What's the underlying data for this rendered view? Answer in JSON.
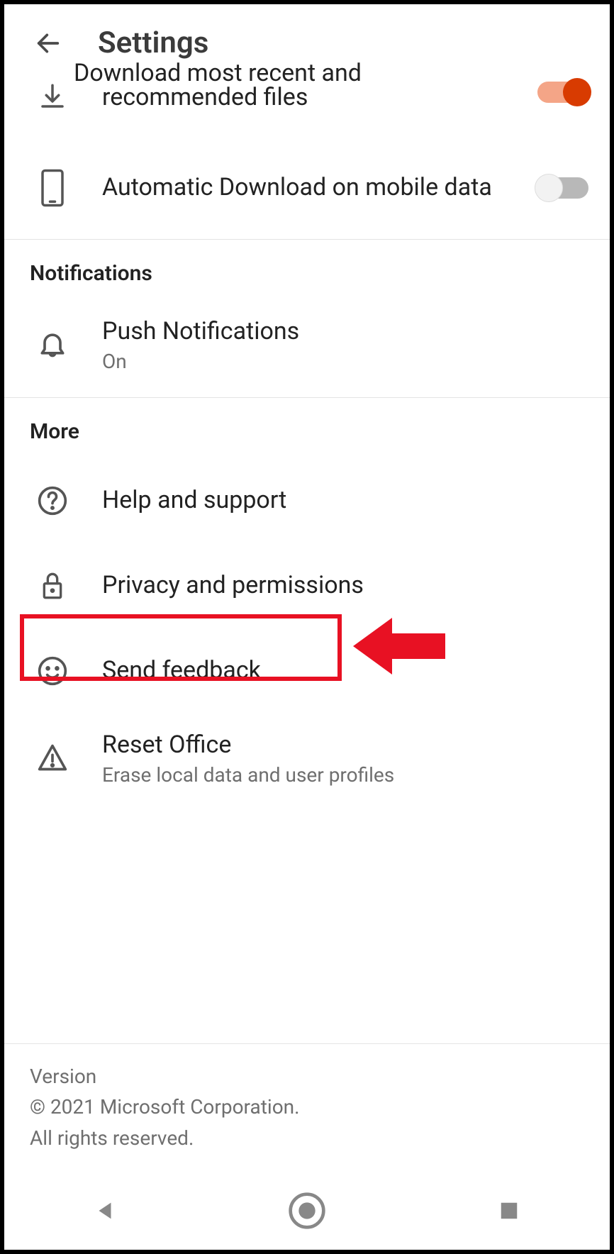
{
  "header": {
    "title": "Settings"
  },
  "rows": {
    "download_recent": {
      "label_partial_top": "Download most recent and",
      "label": "recommended files",
      "toggle_on": true
    },
    "auto_download": {
      "label": "Automatic Download on mobile data",
      "toggle_on": false
    },
    "push": {
      "label": "Push Notifications",
      "sub": "On"
    },
    "help": {
      "label": "Help and support"
    },
    "privacy": {
      "label": "Privacy and permissions"
    },
    "feedback": {
      "label": "Send feedback"
    },
    "reset": {
      "label": "Reset Office",
      "sub": "Erase local data and user profiles"
    }
  },
  "sections": {
    "notifications": "Notifications",
    "more": "More"
  },
  "footer": {
    "l1": "Version",
    "l2": "© 2021 Microsoft Corporation.",
    "l3": "All rights reserved."
  }
}
